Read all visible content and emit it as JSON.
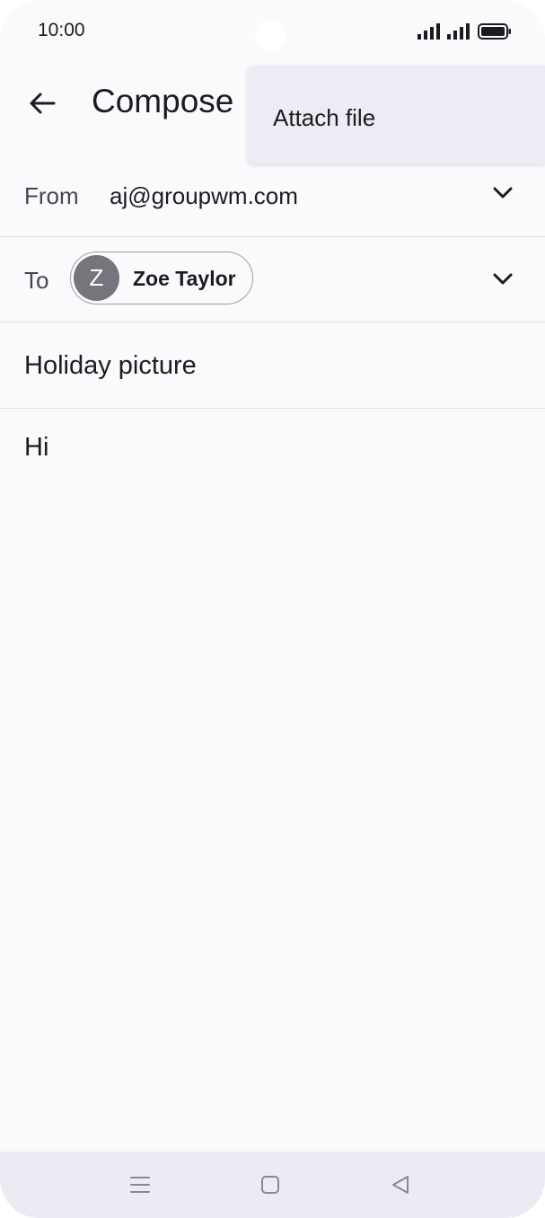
{
  "status_bar": {
    "time": "10:00",
    "icons": [
      "signal-icon",
      "signal-icon",
      "battery-icon"
    ]
  },
  "app_bar": {
    "back_icon": "arrow-back-icon",
    "title": "Compose"
  },
  "overflow_menu": {
    "items": [
      {
        "label": "Attach file"
      }
    ]
  },
  "form": {
    "from": {
      "label": "From",
      "value": "aj@groupwm.com",
      "chevron_icon": "chevron-down-icon"
    },
    "to": {
      "label": "To",
      "recipients": [
        {
          "initial": "Z",
          "name": "Zoe Taylor",
          "avatar_color": "#76747c"
        }
      ],
      "chevron_icon": "chevron-down-icon"
    },
    "subject": "Holiday picture",
    "body": "Hi"
  },
  "nav_bar": {
    "buttons": [
      "menu-icon",
      "home-icon",
      "back-triangle-icon"
    ]
  },
  "colors": {
    "background": "#fcf9fc",
    "menu_background": "#eeebf5",
    "nav_background": "#edeaf4",
    "divider": "#e3e0e6"
  }
}
